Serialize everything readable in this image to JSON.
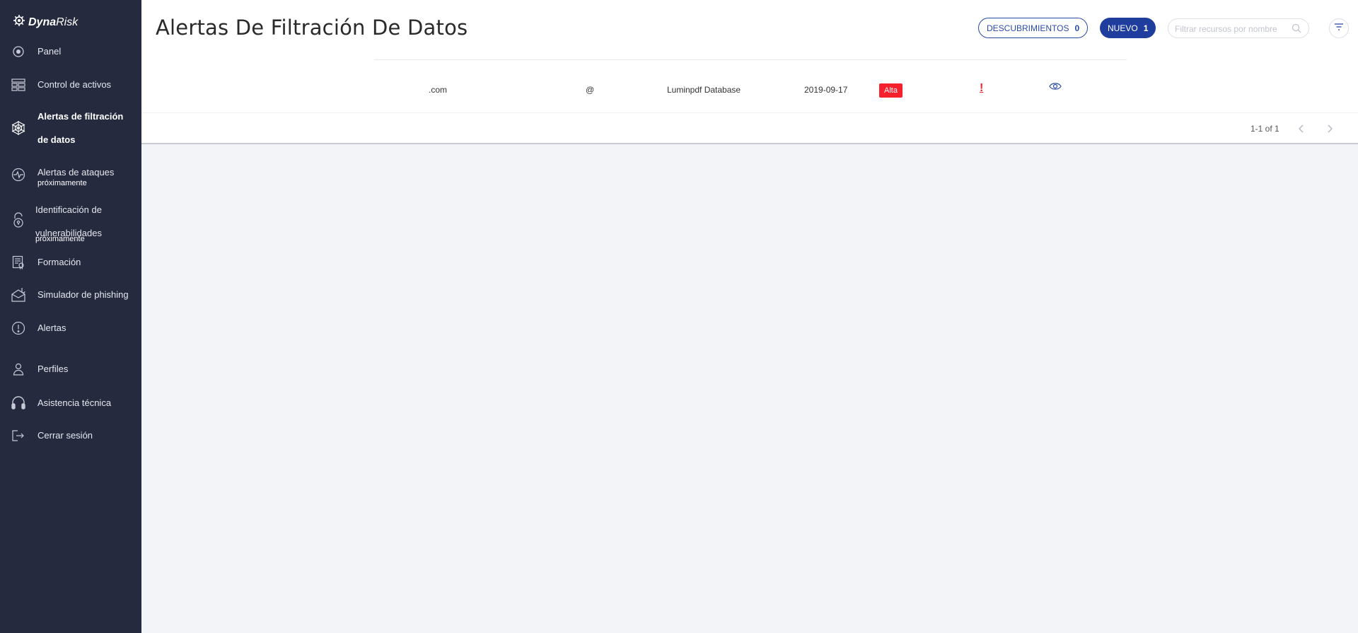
{
  "brand": {
    "name_bold": "Dyna",
    "name_light": "Risk"
  },
  "sidebar": {
    "items": [
      {
        "label": "Panel",
        "icon": "target-icon"
      },
      {
        "label": "Control de activos",
        "icon": "assets-icon"
      },
      {
        "label_line1": "Alertas de filtración",
        "label_line2": "de datos",
        "icon": "spider-web-icon",
        "active": true
      },
      {
        "label": "Alertas de ataques",
        "sub": "próximamente",
        "icon": "pulse-icon"
      },
      {
        "label_line1": "Identificación de",
        "label_line2": "vulnerabilidades",
        "sub": "próximamente",
        "icon": "lock-icon"
      },
      {
        "label": "Formación",
        "icon": "certificate-icon"
      },
      {
        "label": "Simulador de phishing",
        "icon": "phishing-icon"
      },
      {
        "label": "Alertas",
        "icon": "alert-circle-icon"
      },
      {
        "label": "Perfiles",
        "icon": "user-icon"
      },
      {
        "label": "Asistencia técnica",
        "icon": "headset-icon"
      },
      {
        "label": "Cerrar sesión",
        "icon": "logout-icon"
      }
    ]
  },
  "header": {
    "title": "Alertas De Filtración De Datos",
    "descubrimientos_label": "DESCUBRIMIENTOS",
    "descubrimientos_count": "0",
    "nuevo_label": "NUEVO",
    "nuevo_count": "1",
    "search_placeholder": "Filtrar recursos por nombre"
  },
  "table": {
    "rows": [
      {
        "domain": ".com",
        "email": "@",
        "source": "Luminpdf Database",
        "date": "2019-09-17",
        "severity": "Alta",
        "flag": "!"
      }
    ]
  },
  "pagination": {
    "text": "1-1 of 1"
  },
  "colors": {
    "sidebar_bg": "#252a3e",
    "accent": "#1f3d9c",
    "severity_high": "#f5222d",
    "page_bg": "#f3f4f8"
  }
}
